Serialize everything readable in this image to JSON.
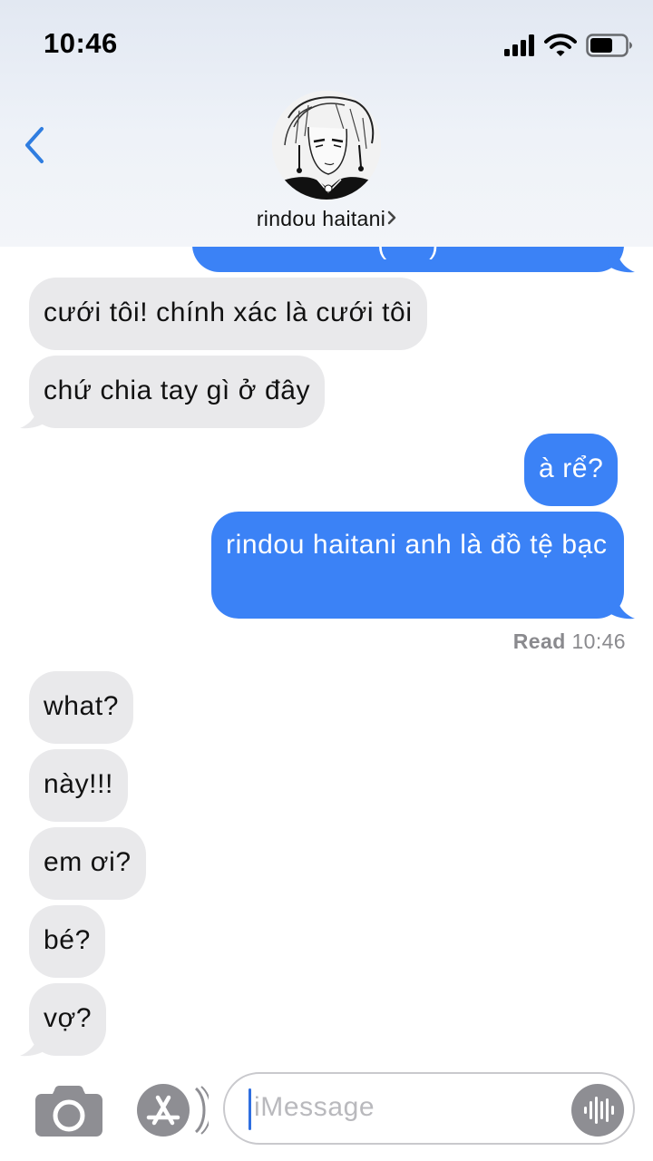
{
  "status_bar": {
    "time": "10:46"
  },
  "header": {
    "contact_name": "rindou haitani",
    "avatar_icon": "contact-avatar-manga-portrait",
    "back_icon": "chevron-left-icon"
  },
  "messages": [
    {
      "direction": "out",
      "text": "(╯ ╯)",
      "partial": true
    },
    {
      "direction": "in",
      "text": "cưới tôi! chính xác là cưới tôi"
    },
    {
      "direction": "in",
      "text": "chứ chia tay gì ở đây"
    },
    {
      "direction": "out",
      "text": "à rể?"
    },
    {
      "direction": "out",
      "text": "rindou haitani anh là đồ tệ bạc"
    },
    {
      "direction": "in",
      "text": "what?"
    },
    {
      "direction": "in",
      "text": "này!!!"
    },
    {
      "direction": "in",
      "text": "em ơi?"
    },
    {
      "direction": "in",
      "text": "bé?"
    },
    {
      "direction": "in",
      "text": "vợ?"
    }
  ],
  "read_receipt": {
    "label": "Read",
    "time": "10:46"
  },
  "input_bar": {
    "placeholder": "iMessage",
    "camera_icon": "camera-icon",
    "appstore_icon": "app-store-icon",
    "voice_icon": "audio-waveform-icon"
  },
  "colors": {
    "outgoing_bubble": "#3b82f6",
    "incoming_bubble": "#e9e9eb",
    "accent": "#2f7de0"
  }
}
